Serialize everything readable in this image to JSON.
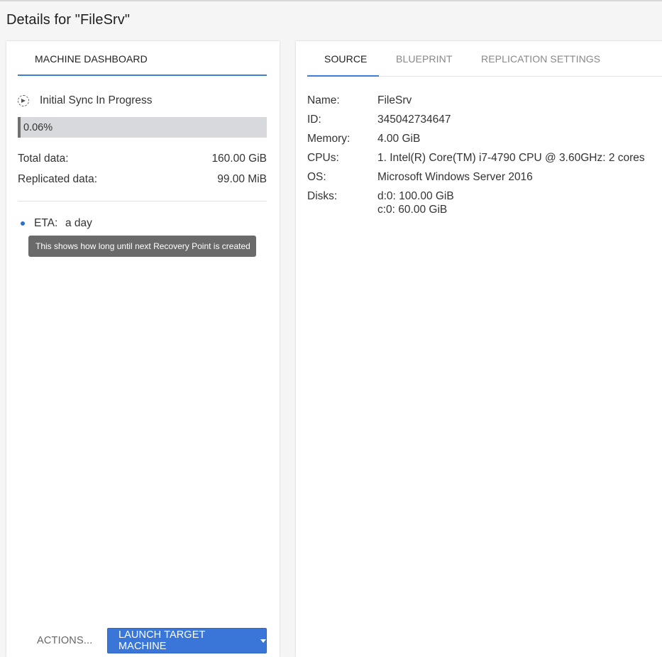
{
  "page": {
    "title": "Details for \"FileSrv\""
  },
  "dashboard": {
    "tab_label": "MACHINE DASHBOARD",
    "sync_status": "Initial Sync In Progress",
    "progress_text": "0.06%",
    "progress_fraction": 0.0006,
    "stats": [
      {
        "label": "Total data:",
        "value": "160.00 GiB"
      },
      {
        "label": "Replicated data:",
        "value": "99.00 MiB"
      }
    ],
    "eta_label": "ETA:",
    "eta_value": "a day",
    "tooltip": "This shows how long until next Recovery Point is created",
    "actions_label": "ACTIONS...",
    "launch_label": "LAUNCH TARGET MACHINE"
  },
  "details": {
    "tabs": [
      {
        "label": "SOURCE",
        "active": true
      },
      {
        "label": "BLUEPRINT",
        "active": false
      },
      {
        "label": "REPLICATION SETTINGS",
        "active": false
      }
    ],
    "rows": [
      {
        "key": "Name:",
        "value": "FileSrv"
      },
      {
        "key": "ID:",
        "value": "345042734647"
      },
      {
        "key": "Memory:",
        "value": "4.00 GiB"
      },
      {
        "key": "CPUs:",
        "value": "1. Intel(R) Core(TM) i7-4790 CPU @ 3.60GHz: 2 cores"
      },
      {
        "key": "OS:",
        "value": "Microsoft Windows Server 2016"
      },
      {
        "key": "Disks:",
        "value": "d:0: 100.00 GiB",
        "value2": "c:0: 60.00 GiB"
      }
    ]
  },
  "colors": {
    "accent": "#3f7ed8",
    "button_bg": "#3a75d8",
    "progress_track": "#d7d9dc",
    "progress_fill": "#707070",
    "tooltip_bg": "#6a6a6a"
  },
  "icons": {
    "sync": "sync-progress-icon",
    "caret": "caret-down-icon"
  }
}
